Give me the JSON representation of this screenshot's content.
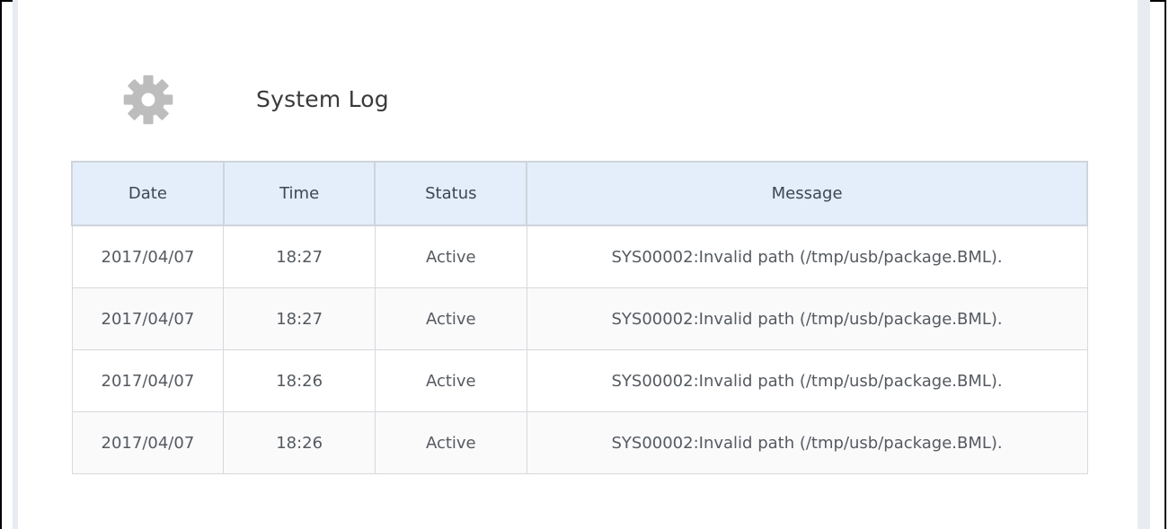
{
  "page": {
    "title": "System Log",
    "icon": "gear-icon"
  },
  "colors": {
    "header_bg": "#e4eefb",
    "icon": "#bdbdbd",
    "text": "#555a60"
  },
  "table": {
    "columns": [
      "Date",
      "Time",
      "Status",
      "Message"
    ],
    "rows": [
      {
        "date": "2017/04/07",
        "time": "18:27",
        "status": "Active",
        "message": "SYS00002:Invalid path (/tmp/usb/package.BML)."
      },
      {
        "date": "2017/04/07",
        "time": "18:27",
        "status": "Active",
        "message": "SYS00002:Invalid path (/tmp/usb/package.BML)."
      },
      {
        "date": "2017/04/07",
        "time": "18:26",
        "status": "Active",
        "message": "SYS00002:Invalid path (/tmp/usb/package.BML)."
      },
      {
        "date": "2017/04/07",
        "time": "18:26",
        "status": "Active",
        "message": "SYS00002:Invalid path (/tmp/usb/package.BML)."
      }
    ]
  }
}
